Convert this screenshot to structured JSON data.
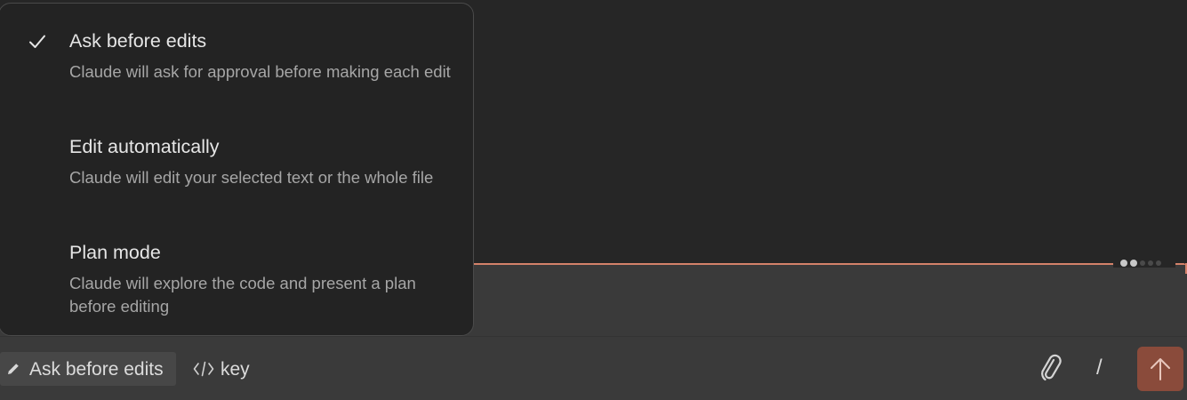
{
  "mode_menu": {
    "items": [
      {
        "title": "Ask before edits",
        "description": "Claude will ask for approval before making each edit",
        "selected": true,
        "icon": "check-icon"
      },
      {
        "title": "Edit automatically",
        "description": "Claude will edit your selected text or the whole file",
        "selected": false
      },
      {
        "title": "Plan mode",
        "description": "Claude will explore the code and present a plan before editing",
        "selected": false
      }
    ]
  },
  "toolbar": {
    "mode_chip": {
      "label": "Ask before edits",
      "icon": "pencil-icon"
    },
    "file_ref": {
      "label": "key",
      "icon": "code-icon"
    },
    "attach": {
      "icon": "paperclip-icon"
    },
    "slash": {
      "label": "/"
    },
    "send": {
      "icon": "arrow-up-icon"
    }
  },
  "colors": {
    "background": "#262626",
    "input_background": "#3a3a3a",
    "accent": "#d4826a",
    "send_button": "#8a4b3b",
    "menu_background": "#232323"
  }
}
